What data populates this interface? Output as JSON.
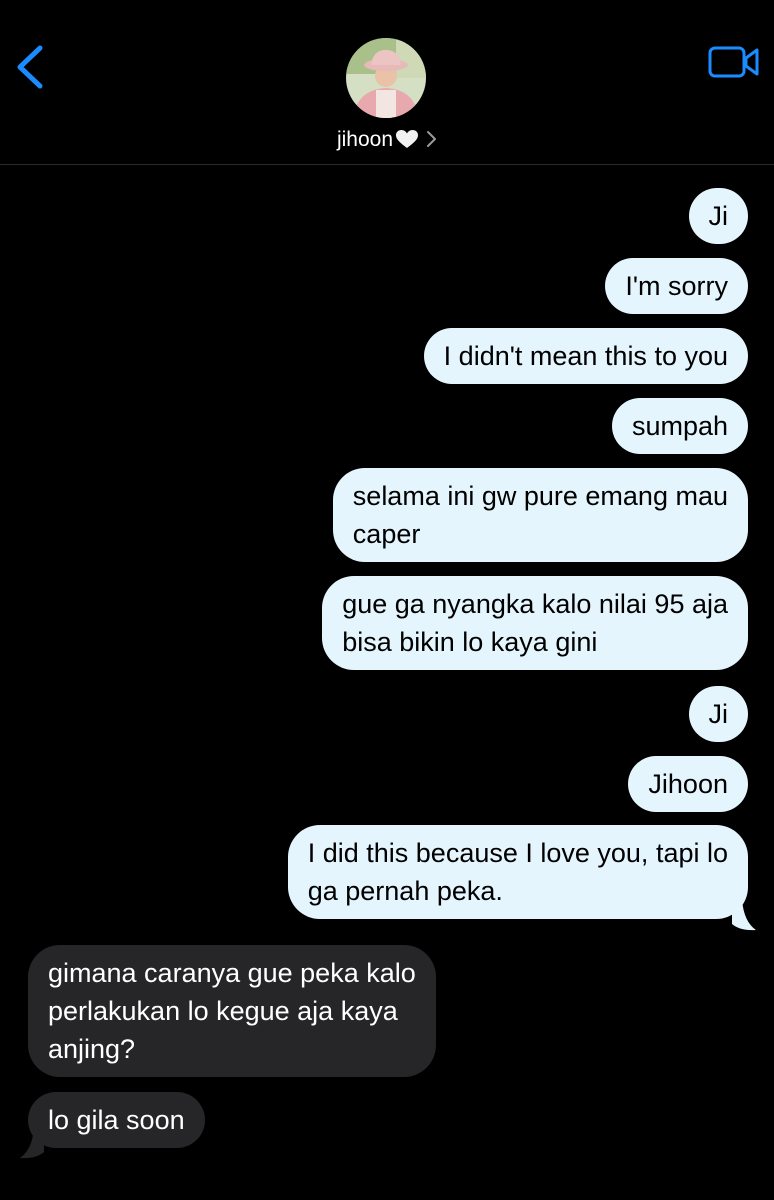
{
  "header": {
    "contact_name": "jihoon",
    "back_icon": "chevron-left-icon",
    "video_icon": "video-camera-icon",
    "accent_color": "#1a8cff"
  },
  "messages": [
    {
      "from": "me",
      "text": "Ji"
    },
    {
      "from": "me",
      "text": "I'm sorry"
    },
    {
      "from": "me",
      "text": "I didn't mean this to you"
    },
    {
      "from": "me",
      "text": "sumpah"
    },
    {
      "from": "me",
      "lines": [
        "selama ini gw pure emang mau",
        "caper"
      ]
    },
    {
      "from": "me",
      "lines": [
        "gue ga nyangka kalo nilai 95 aja",
        "bisa bikin lo kaya gini"
      ]
    },
    {
      "from": "me",
      "text": "Ji"
    },
    {
      "from": "me",
      "text": "Jihoon"
    },
    {
      "from": "me",
      "lines": [
        "I did this because I love you, tapi lo",
        "ga pernah peka."
      ]
    },
    {
      "from": "them",
      "lines": [
        "gimana caranya gue peka kalo",
        "perlakukan lo kegue aja kaya",
        "anjing?"
      ]
    },
    {
      "from": "them",
      "text": "lo gila soon"
    }
  ],
  "colors": {
    "sent_bubble": "#e4f5fd",
    "received_bubble": "#262628",
    "background": "#000000"
  }
}
